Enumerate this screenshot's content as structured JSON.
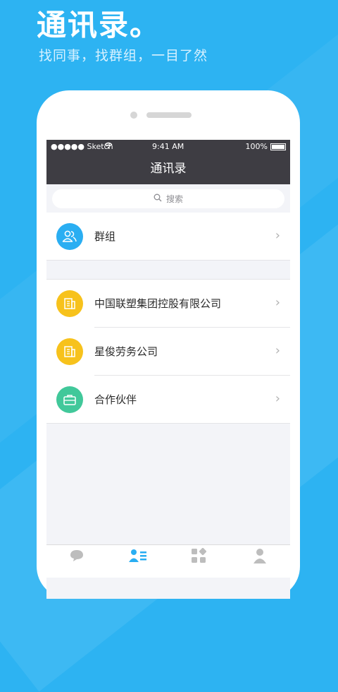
{
  "promo": {
    "headline": "通讯录。",
    "subtitle": "找同事，找群组，一目了然"
  },
  "statusbar": {
    "carrier": "●●●●● Sketch",
    "time": "9:41 AM",
    "battery": "100%"
  },
  "navbar": {
    "title": "通讯录"
  },
  "search": {
    "placeholder": "搜索"
  },
  "groups_item": {
    "label": "群组",
    "icon": "group-icon",
    "color": "#2aaef2"
  },
  "org_items": [
    {
      "label": "中国联塑集团控股有限公司",
      "icon": "building-icon",
      "color": "#f7c21c"
    },
    {
      "label": "星俊劳务公司",
      "icon": "building-icon",
      "color": "#f7c21c"
    },
    {
      "label": "合作伙伴",
      "icon": "briefcase-icon",
      "color": "#41c89a"
    }
  ],
  "tabbar": [
    "chat-icon",
    "contacts-icon",
    "apps-icon",
    "profile-icon"
  ],
  "colors": {
    "background": "#2db3f2",
    "navbar": "#3e3d43",
    "active_tab": "#2aaef2"
  }
}
